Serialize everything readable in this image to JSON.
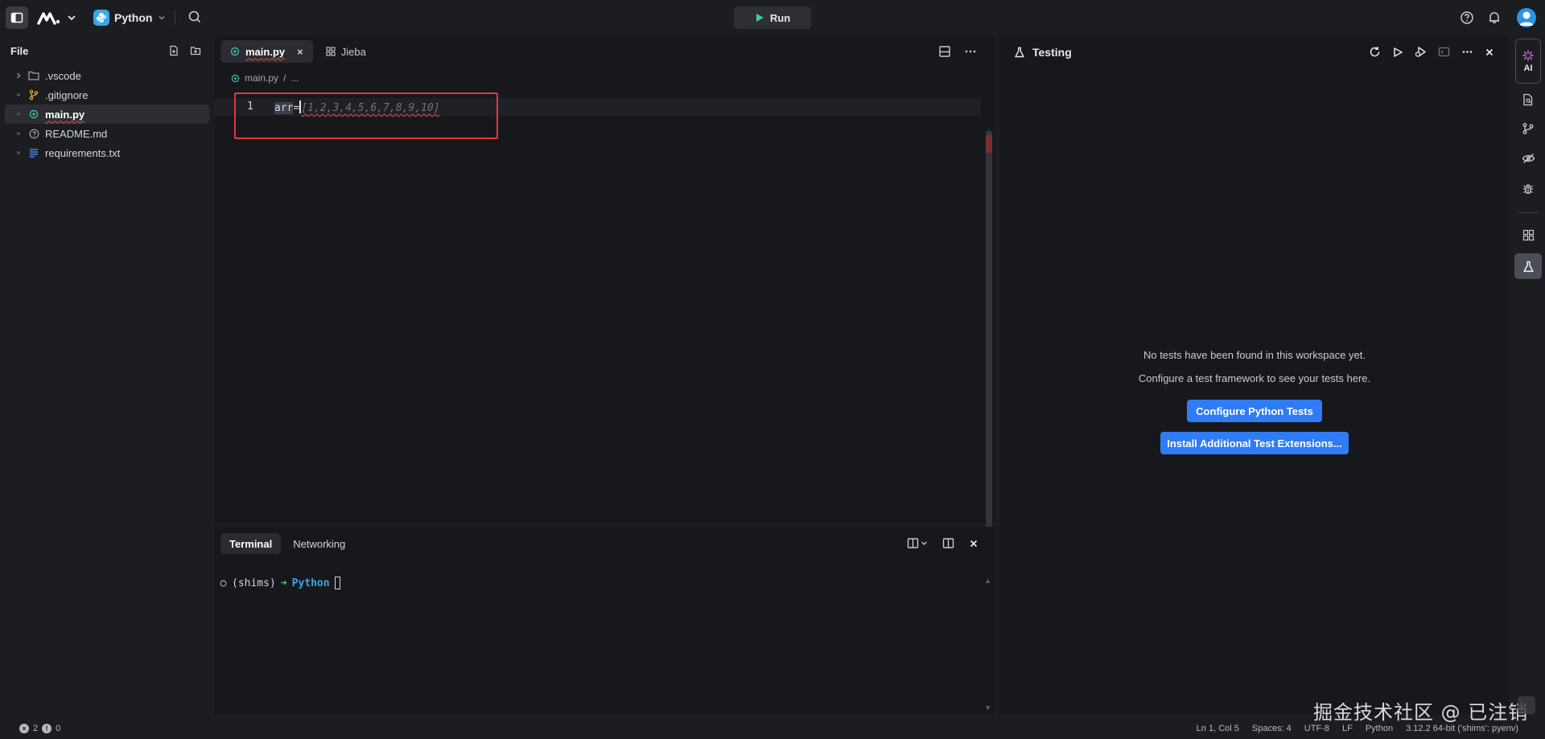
{
  "topbar": {
    "repl_language": "Python",
    "run_label": "Run"
  },
  "filetree": {
    "title": "File",
    "items": [
      {
        "name": ".vscode",
        "type": "folder"
      },
      {
        "name": ".gitignore",
        "type": "git"
      },
      {
        "name": "main.py",
        "type": "python",
        "active": true
      },
      {
        "name": "README.md",
        "type": "readme"
      },
      {
        "name": "requirements.txt",
        "type": "text"
      }
    ]
  },
  "editor": {
    "tabs": [
      {
        "label": "main.py",
        "active": true,
        "close": "×"
      },
      {
        "label": "Jieba",
        "active": false
      }
    ],
    "breadcrumb": [
      "main.py",
      "/",
      "..."
    ],
    "line_number": "1",
    "code_typed_selected": "arr",
    "code_typed_rest": "=",
    "code_ghost": "[1,2,3,4,5,6,7,8,9,10]"
  },
  "terminal": {
    "tabs": [
      "Terminal",
      "Networking"
    ],
    "prompt_env": "(shims)",
    "prompt_arrow": "➜",
    "prompt_dir": "Python"
  },
  "testing": {
    "title": "Testing",
    "empty_line1": "No tests have been found in this workspace yet.",
    "empty_line2": "Configure a test framework to see your tests here.",
    "configure_button": "Configure Python Tests",
    "install_button": "Install Additional Test Extensions..."
  },
  "rightbar": {
    "ai_label": "AI"
  },
  "statusbar": {
    "errors": "2",
    "warnings": "0",
    "position": "Ln 1, Col 5",
    "spaces": "Spaces: 4",
    "encoding": "UTF-8",
    "eol": "LF",
    "language": "Python",
    "interpreter": "3.12.2 64-bit ('shims': pyenv)"
  },
  "watermark": "掘金技术社区 @ 已注销",
  "colors": {
    "accent": "#2f7cf6",
    "python_badge": "#3aa6e6",
    "prompt_arrow": "#3fd08b",
    "highlight_box": "#e03a3a"
  }
}
